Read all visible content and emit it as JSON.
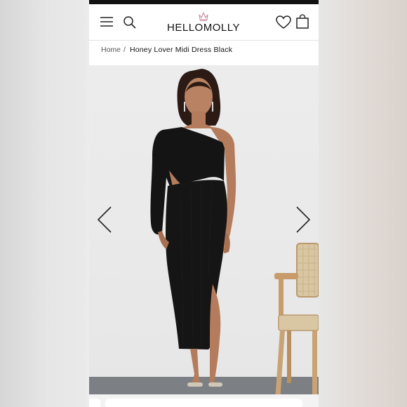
{
  "header": {
    "brand": "HELLOMOLLY",
    "icons": [
      "menu-icon",
      "search-icon",
      "crown-icon",
      "heart-icon",
      "bag-icon"
    ]
  },
  "breadcrumb": {
    "home": "Home",
    "separator": "/",
    "current": "Honey Lover Midi Dress Black"
  },
  "gallery": {
    "product_image": "model-wearing-dress",
    "prev_icon": "chevron-left-icon",
    "next_icon": "chevron-right-icon"
  },
  "colors": {
    "accent_crown": "#c98aa0",
    "text": "#111111",
    "background": "#ffffff"
  }
}
